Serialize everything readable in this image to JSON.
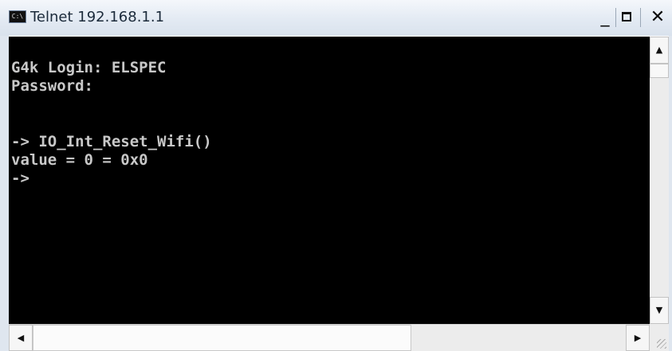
{
  "window": {
    "title": "Telnet 192.168.1.1",
    "icon": "console-window-icon",
    "icon_text": "C:\\",
    "controls": {
      "minimize": "_",
      "maximize": "maximize-icon",
      "close": "✕"
    }
  },
  "console": {
    "background": "#000000",
    "text_color": "#c8c8c8",
    "lines": [
      "G4k Login: ELSPEC",
      "Password:",
      "",
      "",
      "-> IO_Int_Reset_Wifi()",
      "value = 0 = 0x0",
      "->"
    ]
  },
  "scrollbars": {
    "up_arrow": "▲",
    "down_arrow": "▼",
    "left_arrow": "◀",
    "right_arrow": "▶"
  }
}
